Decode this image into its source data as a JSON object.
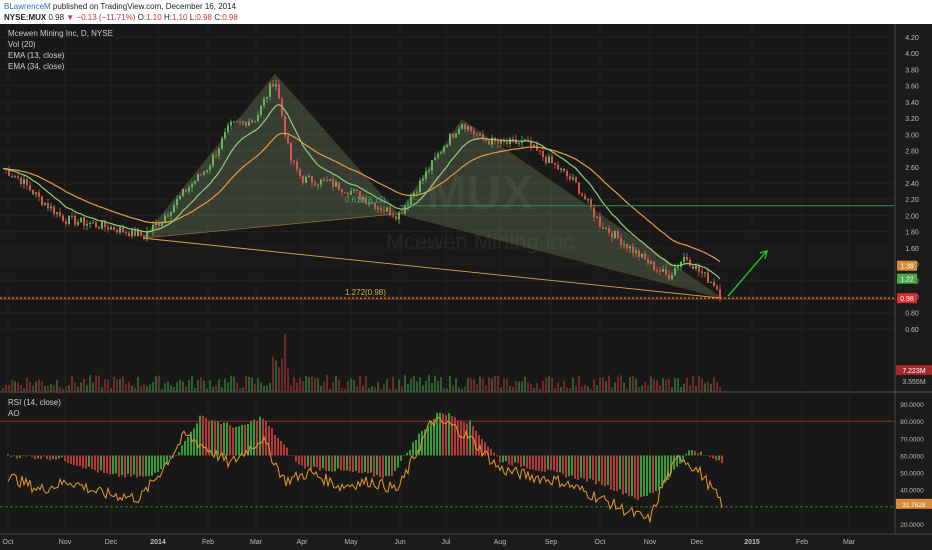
{
  "header": {
    "author": "BLawrenceM",
    "published": " published on TradingView.com, December 16, 2014",
    "symbol": "NYSE:MUX",
    "last": "0.98",
    "change": "▼ −0.13 (−11.71%)",
    "o_label": "O:",
    "o_val": "1.10",
    "h_label": "H:",
    "h_val": "1.10",
    "l_label": "L:",
    "l_val": "0.98",
    "c_label": "C:",
    "c_val": "0.98"
  },
  "legend": {
    "title": "Mcewen Mining Inc, D, NYSE",
    "vol": "Vol (20)",
    "ema13": "EMA (13, close)",
    "ema34": "EMA (34, close)",
    "rsi": "RSI (14, close)",
    "ao": "AO"
  },
  "watermark": {
    "symbol": "MUX",
    "name": "Mcewen Mining Inc"
  },
  "annotations": {
    "fib_0618": "0.618(2.12)",
    "fib_1272": "1.272(0.98)"
  },
  "price_axis": {
    "ticks": [
      "4.20",
      "4.00",
      "3.80",
      "3.60",
      "3.40",
      "3.20",
      "3.00",
      "2.80",
      "2.60",
      "2.40",
      "2.20",
      "2.00",
      "1.80",
      "1.60",
      "1.40",
      "1.20",
      "1.00",
      "0.80",
      "0.60"
    ],
    "badges": {
      "ema34": "1.38",
      "ema13": "1.22",
      "last": "0.98",
      "vol1": "7.223M",
      "vol2": "3.555M"
    }
  },
  "rsi_axis": {
    "ticks": [
      "90.0000",
      "80.0000",
      "70.0000",
      "60.0000",
      "50.0000",
      "40.0000",
      "20.0000"
    ],
    "badge": "31.7628"
  },
  "time_axis": {
    "labels": [
      "Oct",
      "Nov",
      "Dec",
      "2014",
      "Feb",
      "Mar",
      "Apr",
      "May",
      "Jun",
      "Jul",
      "Aug",
      "Sep",
      "Oct",
      "Nov",
      "Dec",
      "2015",
      "Feb",
      "Mar"
    ]
  },
  "colors": {
    "bg": "#1b1b1b",
    "up": "#5cb85c",
    "down": "#d9534f",
    "ema13": "#8fcf7a",
    "ema34": "#e39a4a",
    "pattern": "#d7a24a",
    "fib_line": "#2e8f5a",
    "fib_1272": "#e0b030",
    "arrow": "#22cc22",
    "rsi": "#e69a2a",
    "rsi_level": "#c03030",
    "rsi_level_low": "#3a8f3a"
  },
  "chart_data": {
    "type": "line",
    "title": "Mcewen Mining Inc, D, NYSE",
    "xlabel": "",
    "ylabel": "",
    "ylim": [
      0.6,
      4.2
    ],
    "x": [
      "Oct",
      "Nov",
      "Dec",
      "2014",
      "Feb",
      "Mar",
      "Apr",
      "May",
      "Jun",
      "Jul",
      "Aug",
      "Sep",
      "Oct",
      "Nov",
      "Dec"
    ],
    "series": [
      {
        "name": "",
        "values": [
          2.55,
          2.3,
          1.95,
          1.85,
          2.45,
          3.0,
          3.55,
          2.55,
          2.35,
          2.1,
          2.9,
          2.95,
          2.2,
          1.55,
          1.1
        ]
      },
      {
        "name": "EMA (13, close)",
        "values": [
          2.5,
          2.3,
          2.0,
          1.9,
          2.3,
          2.85,
          3.05,
          2.6,
          2.35,
          2.25,
          2.8,
          2.8,
          2.25,
          1.7,
          1.22
        ]
      },
      {
        "name": "EMA (34, close)",
        "values": [
          2.45,
          2.35,
          2.1,
          1.95,
          2.15,
          2.65,
          2.9,
          2.7,
          2.45,
          2.3,
          2.65,
          2.85,
          2.45,
          1.9,
          1.38
        ]
      }
    ],
    "pattern_points": [
      {
        "date": "Dec 2013",
        "price": 1.72
      },
      {
        "date": "Mar 2014",
        "price": 3.74
      },
      {
        "date": "Jun 2014",
        "price": 2.02
      },
      {
        "date": "Jul 2014",
        "price": 3.18
      },
      {
        "date": "Dec 2014",
        "price": 0.98
      }
    ],
    "fib_levels": [
      {
        "label": "0.618(2.12)",
        "price": 2.12
      },
      {
        "label": "1.272(0.98)",
        "price": 0.98
      }
    ],
    "rsi": {
      "name": "RSI (14, close)",
      "ylim": [
        20,
        90
      ],
      "levels": [
        80,
        30
      ],
      "last": 31.7628
    }
  }
}
